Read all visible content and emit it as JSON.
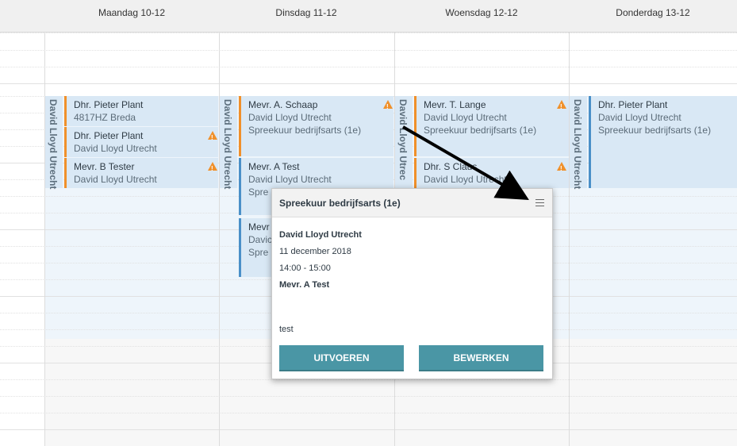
{
  "days": [
    {
      "label": "Maandag 10-12"
    },
    {
      "label": "Dinsdag 11-12"
    },
    {
      "label": "Woensdag 12-12"
    },
    {
      "label": "Donderdag 13-12"
    }
  ],
  "location": "David Lloyd Utrecht",
  "location_short": "David Lloyd Utrec",
  "appointments": {
    "mon_1": {
      "name": "Dhr. Pieter Plant",
      "line2": "4817HZ Breda"
    },
    "mon_2": {
      "name": "Dhr. Pieter Plant",
      "line2": "David Lloyd Utrecht"
    },
    "mon_3": {
      "name": "Mevr. B Tester",
      "line2": "David Lloyd Utrecht"
    },
    "tue_1": {
      "name": "Mevr. A. Schaap",
      "line2": "David Lloyd Utrecht",
      "line3": "Spreekuur bedrijfsarts (1e)"
    },
    "tue_2": {
      "name": "Mevr. A Test",
      "line2": "David Lloyd Utrecht",
      "line3": "Spre"
    },
    "tue_3": {
      "name": "Mevr",
      "line2": "Davic",
      "line3": "Spre"
    },
    "wed_1": {
      "name": "Mevr. T. Lange",
      "line2": "David Lloyd Utrecht",
      "line3": "Spreekuur bedrijfsarts (1e)"
    },
    "wed_2": {
      "name": "Dhr. S Claus",
      "line2": "David Lloyd Utrecht"
    },
    "thu_1": {
      "name": "Dhr. Pieter Plant",
      "line2": "David Lloyd Utrecht",
      "line3": "Spreekuur bedrijfsarts (1e)"
    }
  },
  "popup": {
    "title": "Spreekuur bedrijfsarts (1e)",
    "location": "David Lloyd Utrecht",
    "date": "11 december 2018",
    "time": "14:00 - 15:00",
    "client": "Mevr. A Test",
    "note": "test",
    "execute_label": "UITVOEREN",
    "edit_label": "BEWERKEN"
  },
  "colors": {
    "accent": "#4a96a5",
    "warning": "#f0902a",
    "appointment_bg": "#d9e8f5",
    "border_blue": "#4a90c8"
  },
  "icons": {
    "menu": "hamburger-menu-icon",
    "warning": "warning-triangle-icon"
  }
}
